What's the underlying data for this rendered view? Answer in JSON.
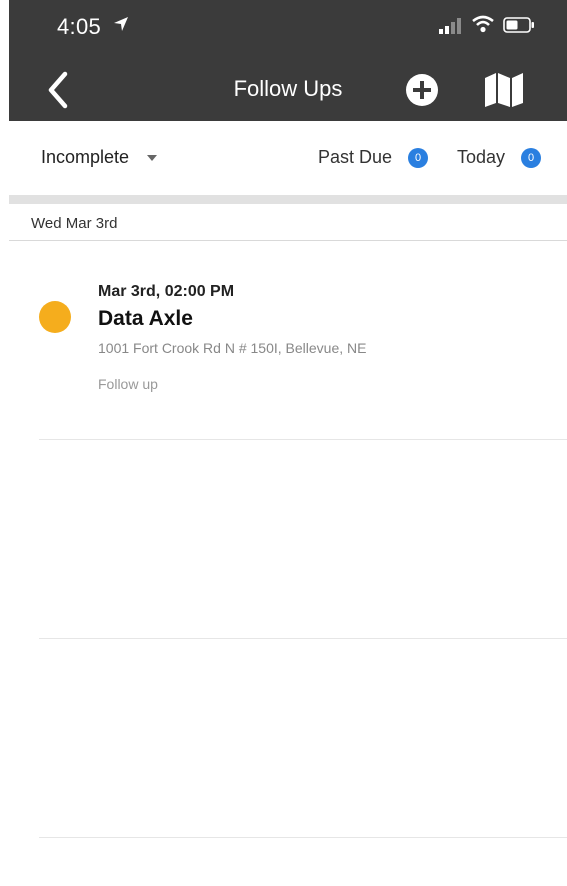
{
  "status_bar": {
    "time": "4:05"
  },
  "nav": {
    "title": "Follow Ups"
  },
  "filter": {
    "selected": "Incomplete",
    "past_due_label": "Past Due",
    "past_due_count": "0",
    "today_label": "Today",
    "today_count": "0"
  },
  "section": {
    "date": "Wed Mar 3rd"
  },
  "items": [
    {
      "time": "Mar 3rd, 02:00 PM",
      "name": "Data Axle",
      "address": "1001 Fort Crook Rd N # 150I, Bellevue, NE",
      "type": "Follow up",
      "status_color": "#f5ad1d"
    }
  ],
  "colors": {
    "header_bg": "#3b3b3b",
    "badge": "#2a7fe0",
    "accent_dot": "#f5ad1d"
  },
  "icons": [
    "location-arrow-icon",
    "signal-icon",
    "wifi-icon",
    "battery-icon",
    "back-chevron-icon",
    "add-circle-icon",
    "map-icon",
    "caret-down-icon"
  ]
}
